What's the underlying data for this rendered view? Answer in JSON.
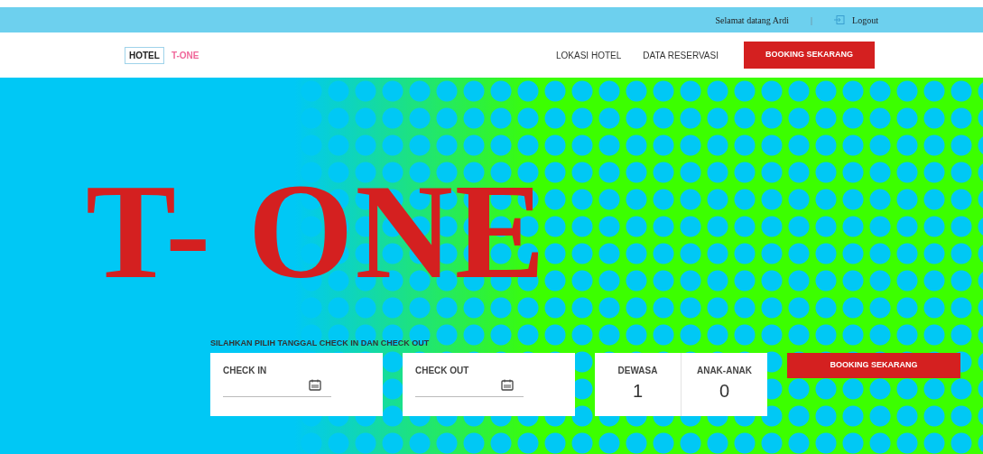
{
  "top_bar": {
    "greeting": "Selamat datang Ardi",
    "separator": "|",
    "logout": "Logout"
  },
  "navbar": {
    "logo": {
      "word_1": "HOTEL",
      "word_2": "T-ONE"
    },
    "links": [
      "LOKASI HOTEL",
      "DATA RESERVASI"
    ],
    "cta": "BOOKING SEKARANG"
  },
  "hero": {
    "title": "T- ONE"
  },
  "booking": {
    "instruction": "SILAHKAN PILIH TANGGAL CHECK IN DAN CHECK OUT",
    "date_fields": [
      {
        "label": "CHECK IN"
      },
      {
        "label": "CHECK OUT"
      }
    ],
    "guests": [
      {
        "label": "DEWASA",
        "value": "1"
      },
      {
        "label": "ANAK-ANAK",
        "value": "0"
      }
    ],
    "button": "BOOKING SEKARANG"
  }
}
